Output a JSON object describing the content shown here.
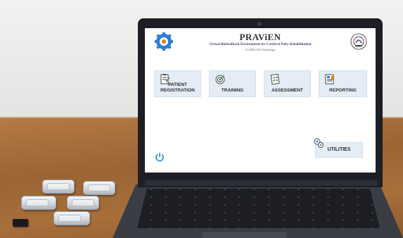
{
  "app": {
    "title": "PRAViEN",
    "subtitle": "Virtual Biofeedback Environment for Cerebral Palsy Rehabilitation",
    "tagline": "A CSIR-CSIO Technology"
  },
  "tiles": [
    {
      "label_line1": "PATIENT",
      "label_line2": "REGISTRATION",
      "icon": "clipboard-icon"
    },
    {
      "label_line1": "",
      "label_line2": "TRAINING",
      "icon": "target-icon"
    },
    {
      "label_line1": "",
      "label_line2": "ASSESSMENT",
      "icon": "checklist-icon"
    },
    {
      "label_line1": "",
      "label_line2": "REPORTING",
      "icon": "report-icon"
    }
  ],
  "utilities": {
    "label": "UTILITIES",
    "icon": "gears-icon"
  },
  "power": {
    "icon": "power-icon"
  },
  "colors": {
    "tile_bg": "#e4edf6",
    "accent_blue": "#1e88e5",
    "lid": "#1d1f24",
    "desk": "#a86f3b"
  }
}
